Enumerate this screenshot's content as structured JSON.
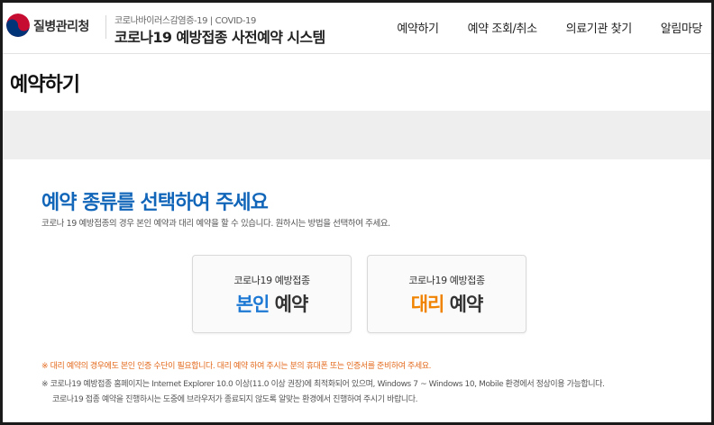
{
  "header": {
    "agency_name": "질병관리청",
    "subtitle": "코로나바이러스감염증-19 | COVID-19",
    "system_title": "코로나19 예방접종 사전예약 시스템",
    "nav": [
      {
        "label": "예약하기"
      },
      {
        "label": "예약 조회/취소"
      },
      {
        "label": "의료기관 찾기"
      },
      {
        "label": "알림마당"
      }
    ]
  },
  "page": {
    "title": "예약하기"
  },
  "main": {
    "heading": "예약 종류를 선택하여 주세요",
    "description": "코로나 19 예방접종의 경우 본인 예약과 대리 예약을 할 수 있습니다. 원하시는 방법을 선택하여 주세요.",
    "cards": {
      "self": {
        "top": "코로나19 예방접종",
        "accent": "본인",
        "suffix": " 예약"
      },
      "proxy": {
        "top": "코로나19 예방접종",
        "accent": "대리",
        "suffix": " 예약"
      }
    },
    "notices": {
      "proxy_notice": "※ 대리 예약의 경우에도 본인 인증 수단이 필요합니다. 대리 예약 하여 주시는 분의 휴대폰 또는 인증서를 준비하여 주세요.",
      "browser_notice_1": "※ 코로나19 예방접종 홈페이지는 Internet Explorer 10.0 이상(11.0 이상 권장)에 최적화되어 있으며, Windows 7 ~ Windows 10, Mobile 환경에서 정상이용 가능합니다.",
      "browser_notice_2": "코로나19 접종 예약을 진행하시는 도중에 브라우저가 종료되지 않도록 알맞는 환경에서 진행하여 주시기 바랍니다."
    }
  },
  "colors": {
    "heading_blue": "#1266b9",
    "self_accent": "#1d79d4",
    "proxy_accent": "#f08300",
    "notice_orange": "#e36a1d"
  },
  "icons": {
    "logo": "taegeuk-logo-icon"
  }
}
